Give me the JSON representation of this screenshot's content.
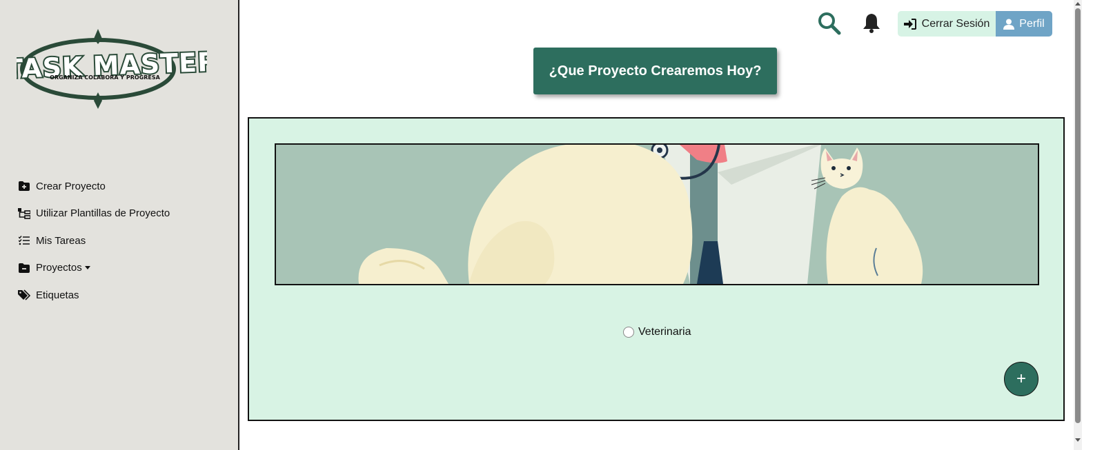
{
  "brand": {
    "logo_title": "TASK MASTER",
    "logo_subtitle": "ORGANIZA COLABORA Y PROGRESA"
  },
  "sidebar": {
    "items": [
      {
        "label": "Crear Proyecto",
        "icon": "folder-plus-icon"
      },
      {
        "label": "Utilizar Plantillas de Proyecto",
        "icon": "diagram-icon"
      },
      {
        "label": "Mis Tareas",
        "icon": "list-check-icon"
      },
      {
        "label": "Proyectos",
        "icon": "folder-minus-icon",
        "dropdown": true
      },
      {
        "label": "Etiquetas",
        "icon": "tags-icon"
      }
    ]
  },
  "header": {
    "search_icon": "search-icon",
    "notification_icon": "bell-icon",
    "logout_label": "Cerrar Sesión",
    "profile_label": "Perfil"
  },
  "main": {
    "heading": "¿Que Proyecto Crearemos Hoy?",
    "template": {
      "label": "Veterinaria",
      "selected": false
    },
    "add_button_label": "+"
  },
  "colors": {
    "primary": "#2d6e5e",
    "panel_bg": "#d8f3e4",
    "sidebar_bg": "#e3e2dd",
    "profile_bg": "#6fa4c6",
    "logout_bg": "#d7f3e5"
  }
}
